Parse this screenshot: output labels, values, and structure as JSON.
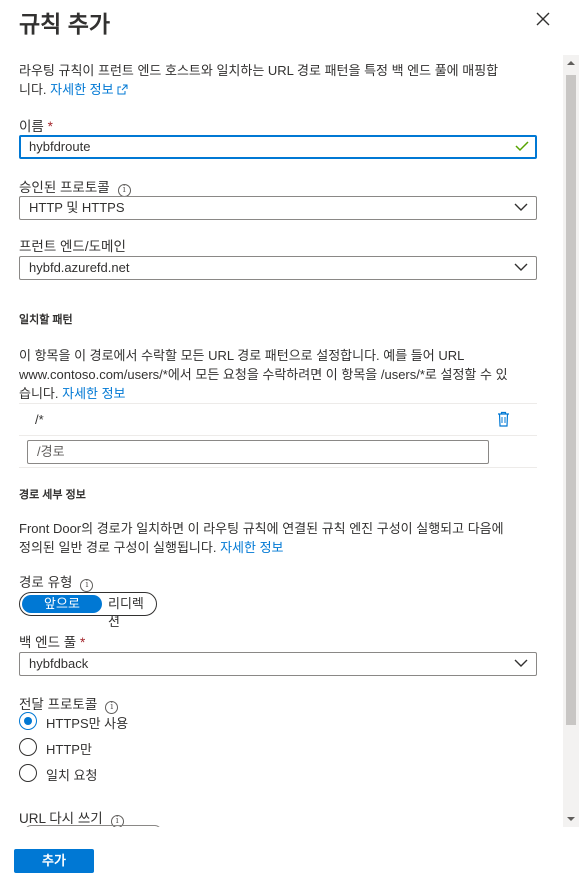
{
  "panel": {
    "title": "규칙 추가",
    "close_icon": "close-icon"
  },
  "intro": {
    "line1": "라우팅 규칙이 프런트 엔드 호스트와 일치하는 URL 경로 패턴을 특정 백 엔드 풀에 매핑합",
    "line2_prefix": "니다. ",
    "learn_more": "자세한 정보"
  },
  "name": {
    "label": "이름",
    "required_mark": "*",
    "value": "hybfdroute"
  },
  "protocols": {
    "label": "승인된 프로토콜",
    "value": "HTTP 및 HTTPS"
  },
  "frontend": {
    "label": "프런트 엔드/도메인",
    "value": "hybfd.azurefd.net"
  },
  "patterns": {
    "section_title": "일치할 패턴",
    "desc1": "이 항목을 이 경로에서 수락할 모든 URL 경로 패턴으로 설정합니다. 예를 들어 URL",
    "desc2": "www.contoso.com/users/*에서 모든 요청을 수락하려면 이 항목을 /users/*로 설정할 수 있",
    "desc3_prefix": "습니다. ",
    "learn_more": "자세한 정보",
    "rows": [
      "/*"
    ],
    "new_placeholder": "/경로"
  },
  "route_details": {
    "section_title": "경로 세부 정보",
    "desc1": "Front Door의 경로가 일치하면 이 라우팅 규칙에 연결된 규칙 엔진 구성이 실행되고 다음에",
    "desc2_prefix": "정의된 일반 경로 구성이 실행됩니다. ",
    "learn_more": "자세한 정보"
  },
  "route_type": {
    "label": "경로 유형",
    "options": [
      "앞으로",
      "리디렉션"
    ],
    "selected": "앞으로"
  },
  "backend_pool": {
    "label": "백 엔드 풀",
    "required_mark": "*",
    "value": "hybfdback"
  },
  "forwarding": {
    "label": "전달 프로토콜",
    "options": [
      "HTTPS만 사용",
      "HTTP만",
      "일치 요청"
    ],
    "selected": "HTTPS만 사용"
  },
  "url_rewrite": {
    "label": "URL 다시 쓰기"
  },
  "footer": {
    "add_label": "추가"
  },
  "colors": {
    "accent": "#0078d4",
    "required": "#a4262c",
    "valid": "#57a300"
  }
}
